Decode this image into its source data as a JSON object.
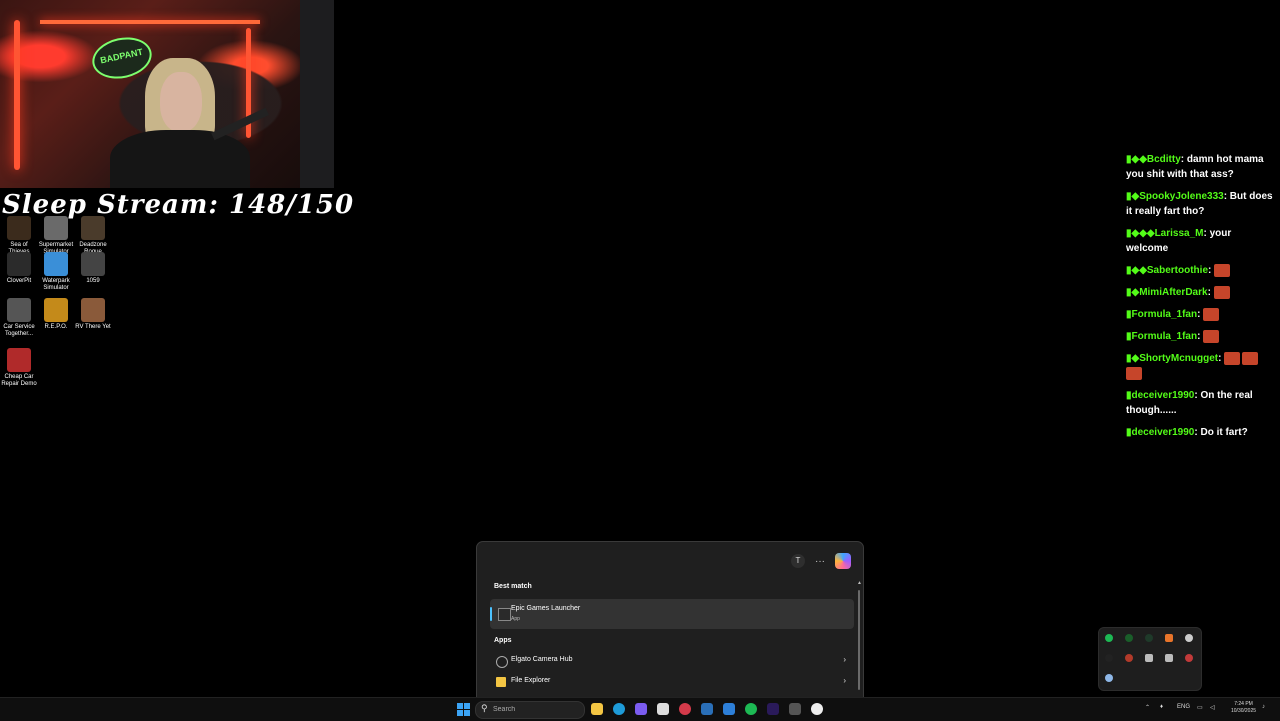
{
  "overlay": {
    "stream_title": "Sleep Stream: 148/150",
    "sticker_text": "BADPANT"
  },
  "desktop_icons": [
    {
      "label": "Sea of Thieves",
      "color": "#3b2b1c"
    },
    {
      "label": "Supermarket Simulator",
      "color": "#6a6a6a"
    },
    {
      "label": "Deadzone Rogue",
      "color": "#4a3b2b"
    },
    {
      "label": "CloverPit",
      "color": "#2b2b2b"
    },
    {
      "label": "Waterpark Simulator",
      "color": "#3a8fd8"
    },
    {
      "label": "1059",
      "color": "#444444"
    },
    {
      "label": "Car Service Together...",
      "color": "#555555"
    },
    {
      "label": "R.E.P.O.",
      "color": "#c48a1a"
    },
    {
      "label": "RV There Yet",
      "color": "#8a5a3a"
    },
    {
      "label": "Cheap Car Repair Demo",
      "color": "#b02a2a"
    }
  ],
  "chat": [
    {
      "user": "Bcditty",
      "text": "damn hot mama you shit with that ass?"
    },
    {
      "user": "SpookyJolene333",
      "text": "But does it really fart tho?"
    },
    {
      "user": "Larissa_M",
      "text": "your welcome"
    },
    {
      "user": "Sabertoothie",
      "text": "",
      "emotes": 1
    },
    {
      "user": "MimiAfterDark",
      "text": "",
      "emotes": 1
    },
    {
      "user": "Formula_1fan",
      "text": "",
      "emotes": 1
    },
    {
      "user": "Formula_1fan",
      "text": "",
      "emotes": 1
    },
    {
      "user": "ShortyMcnugget",
      "text": "",
      "emotes": 3
    },
    {
      "user": "deceiver1990",
      "text": "On the real though......"
    },
    {
      "user": "deceiver1990",
      "text": "Do it fart?"
    }
  ],
  "search_panel": {
    "avatar_letter": "T",
    "more_label": "···",
    "best_match_label": "Best match",
    "best_match": {
      "name": "Epic Games Launcher",
      "type": "App"
    },
    "apps_label": "Apps",
    "apps": [
      {
        "name": "Elgato Camera Hub",
        "icon": "camera-hub-icon"
      },
      {
        "name": "File Explorer",
        "icon": "folder-icon"
      }
    ]
  },
  "taskbar": {
    "search_placeholder": "Search",
    "language": "ENG",
    "time": "7:24 PM",
    "date": "10/30/2025"
  },
  "colors": {
    "chat_username": "#53fc18",
    "accent": "#4cc2ff",
    "panel_bg": "#1f1f1f"
  }
}
